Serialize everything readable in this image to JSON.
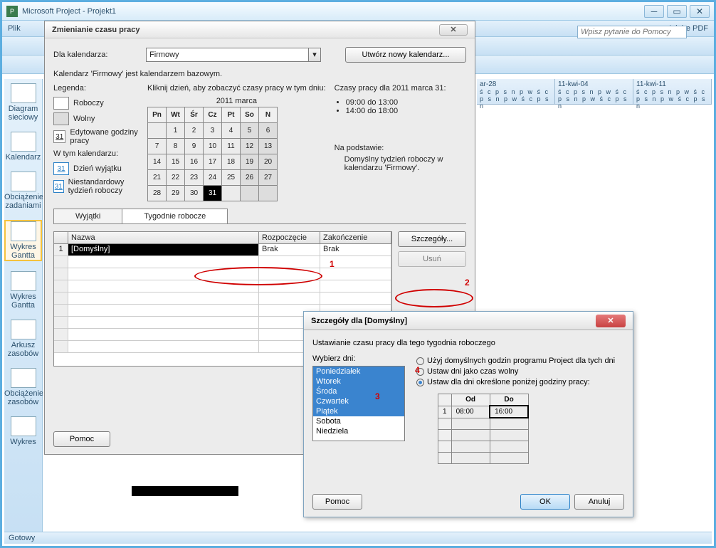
{
  "window": {
    "title": "Microsoft Project - Projekt1",
    "status": "Gotowy",
    "help_placeholder": "Wpisz pytanie do Pomocy"
  },
  "menubar": [
    "Plik",
    "Adobe PDF"
  ],
  "sidenav": [
    {
      "label": "Diagram sieciowy"
    },
    {
      "label": "Kalendarz"
    },
    {
      "label": "Obciążenie zadaniami"
    },
    {
      "label": "Wykres Gantta",
      "selected": true
    },
    {
      "label": "Wykres Gantta"
    },
    {
      "label": "Arkusz zasobów"
    },
    {
      "label": "Obciążenie zasobów"
    },
    {
      "label": "Wykres"
    }
  ],
  "timescale": [
    "ar-28",
    "11-kwi-04",
    "11-kwi-11"
  ],
  "day_letters": "ś c p s n p w ś c p s n p w ś c p s n",
  "dialog1": {
    "title": "Zmienianie czasu pracy",
    "for_cal_label": "Dla kalendarza:",
    "for_cal_value": "Firmowy",
    "new_cal_btn": "Utwórz nowy kalendarz...",
    "base_note": "Kalendarz 'Firmowy' jest kalendarzem bazowym.",
    "legend_title": "Legenda:",
    "legend": {
      "working": "Roboczy",
      "nonworking": "Wolny",
      "edited": "Edytowane godziny pracy",
      "in_cal": "W tym kalendarzu:",
      "exception": "Dzień wyjątku",
      "nonstd": "Niestandardowy tydzień roboczy",
      "num": "31"
    },
    "click_hint": "Kliknij dzień, aby zobaczyć czasy pracy w tym dniu:",
    "month": "2011 marca",
    "weekdays": [
      "Pn",
      "Wt",
      "Śr",
      "Cz",
      "Pt",
      "So",
      "N"
    ],
    "rows": [
      [
        "",
        "1",
        "2",
        "3",
        "4",
        "5",
        "6"
      ],
      [
        "7",
        "8",
        "9",
        "10",
        "11",
        "12",
        "13"
      ],
      [
        "14",
        "15",
        "16",
        "17",
        "18",
        "19",
        "20"
      ],
      [
        "21",
        "22",
        "23",
        "24",
        "25",
        "26",
        "27"
      ],
      [
        "28",
        "29",
        "30",
        "31",
        "",
        "",
        ""
      ]
    ],
    "selected": "31",
    "times_title": "Czasy pracy dla 2011 marca 31:",
    "times": [
      "09:00 do 13:00",
      "14:00 do 18:00"
    ],
    "based_on_label": "Na podstawie:",
    "based_on_text": "Domyślny tydzień roboczy w kalendarzu 'Firmowy'.",
    "tab1": "Wyjątki",
    "tab2": "Tygodnie robocze",
    "grid_head": {
      "name": "Nazwa",
      "start": "Rozpoczęcie",
      "end": "Zakończenie"
    },
    "grid_row": {
      "n": "1",
      "name": "[Domyślny]",
      "start": "Brak",
      "end": "Brak"
    },
    "details_btn": "Szczegóły...",
    "delete_btn": "Usuń",
    "help_btn": "Pomoc",
    "markers": {
      "m1": "1",
      "m2": "2",
      "m3": "3",
      "m4": "4"
    }
  },
  "dialog2": {
    "title": "Szczegóły dla [Domyślny]",
    "subtitle": "Ustawianie czasu pracy dla tego tygodnia roboczego",
    "pick_label": "Wybierz dni:",
    "days": [
      "Poniedziałek",
      "Wtorek",
      "Środa",
      "Czwartek",
      "Piątek",
      "Sobota",
      "Niedziela"
    ],
    "radios": {
      "r1": "Użyj domyślnych godzin programu Project dla tych dni",
      "r2": "Ustaw dni jako czas wolny",
      "r3": "Ustaw dla dni określone poniżej godziny pracy:"
    },
    "time_head": {
      "from": "Od",
      "to": "Do"
    },
    "time_row": {
      "n": "1",
      "from": "08:00",
      "to": "16:00"
    },
    "help_btn": "Pomoc",
    "ok_btn": "OK",
    "cancel_btn": "Anuluj"
  }
}
